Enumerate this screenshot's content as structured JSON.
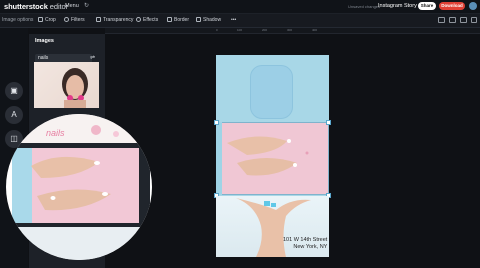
{
  "app": {
    "logo": "shutterstock",
    "logo_suffix": "editor",
    "menu_label": "Menu",
    "undo_icon": "undo-icon",
    "status_text": "Unsaved changes",
    "document_title": "Instagram Story",
    "share_label": "Share",
    "download_label": "Download"
  },
  "toolbar": {
    "label": "Image options",
    "items": [
      {
        "label": "Crop",
        "icon": "crop-icon"
      },
      {
        "label": "Filters",
        "icon": "filters-icon"
      },
      {
        "label": "Transparency",
        "icon": "transparency-icon"
      },
      {
        "label": "Effects",
        "icon": "effects-icon"
      },
      {
        "label": "Border",
        "icon": "border-icon"
      },
      {
        "label": "Shadow",
        "icon": "shadow-icon"
      },
      {
        "label": "•••",
        "icon": "more-icon"
      }
    ]
  },
  "sidebar": {
    "items": [
      {
        "icon": "images-icon",
        "glyph": "▣"
      },
      {
        "icon": "text-icon",
        "glyph": "A"
      },
      {
        "icon": "elements-icon",
        "glyph": "◫"
      }
    ]
  },
  "panel": {
    "title": "Images",
    "search_value": "nails"
  },
  "ruler": {
    "ticks": [
      "0",
      "100",
      "200",
      "300",
      "400"
    ]
  },
  "canvas": {
    "address_line1": "101 W 14th Street",
    "address_line2": "New York, NY"
  },
  "colors": {
    "download": "#e04035",
    "selection": "#5aa6cc",
    "canvas_blue": "#a8d7e7",
    "canvas_pink": "#f0c7d4"
  }
}
